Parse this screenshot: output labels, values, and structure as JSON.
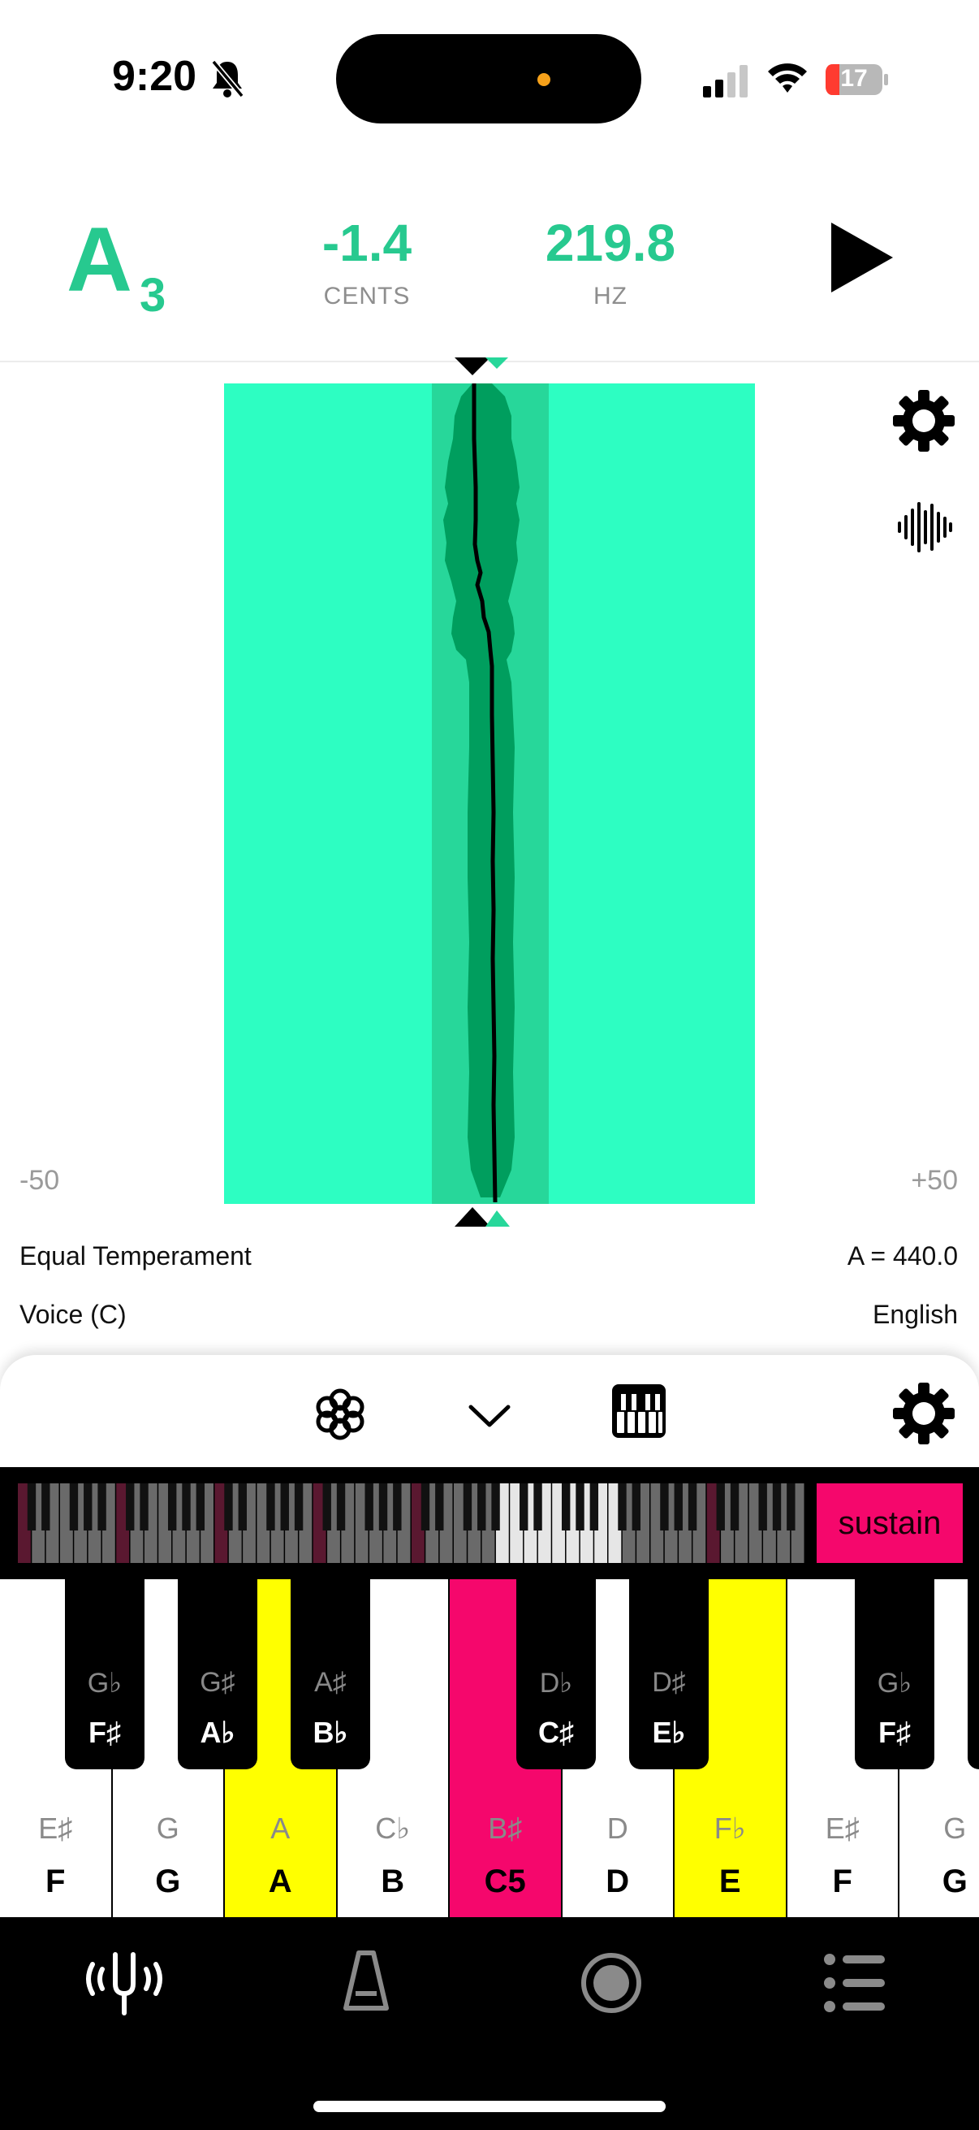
{
  "status_bar": {
    "time": "9:20",
    "battery": "17"
  },
  "header": {
    "note": "A",
    "octave": "3",
    "cents_value": "-1.4",
    "cents_label": "CENTS",
    "hz_value": "219.8",
    "hz_label": "HZ"
  },
  "graph": {
    "scale_min": "-50",
    "scale_max": "+50"
  },
  "settings": {
    "temperament": "Equal Temperament",
    "reference_pitch": "A = 440.0",
    "instrument": "Voice (C)",
    "language": "English"
  },
  "keyboard": {
    "sustain_label": "sustain",
    "white_keys": [
      {
        "alt": "E♯",
        "label": "F",
        "color": "#ffffff"
      },
      {
        "alt": "G",
        "label": "G",
        "color": "#ffffff"
      },
      {
        "alt": "A",
        "label": "A",
        "color": "#ffff00"
      },
      {
        "alt": "C♭",
        "label": "B",
        "color": "#ffffff"
      },
      {
        "alt": "B♯",
        "label": "C5",
        "color": "#f5076c"
      },
      {
        "alt": "D",
        "label": "D",
        "color": "#ffffff"
      },
      {
        "alt": "F♭",
        "label": "E",
        "color": "#ffff00"
      },
      {
        "alt": "E♯",
        "label": "F",
        "color": "#ffffff"
      },
      {
        "alt": "G",
        "label": "G",
        "color": "#ffffff"
      }
    ],
    "black_keys": [
      {
        "alt": "G♭",
        "label": "F♯"
      },
      {
        "alt": "G♯",
        "label": "A♭"
      },
      {
        "alt": "A♯",
        "label": "B♭"
      },
      {
        "alt": "D♭",
        "label": "C♯"
      },
      {
        "alt": "D♯",
        "label": "E♭"
      },
      {
        "alt": "G♭",
        "label": "F♯"
      }
    ]
  },
  "tabs": [
    {
      "icon": "tuning-fork-icon"
    },
    {
      "icon": "metronome-icon"
    },
    {
      "icon": "record-icon"
    },
    {
      "icon": "list-icon"
    }
  ],
  "colors": {
    "accent": "#27c98f",
    "graph_bg": "#2dfec2",
    "graph_band": "#27d79a",
    "trace_fill": "#009e5e",
    "highlight_yellow": "#ffff00",
    "highlight_pink": "#f5076c"
  }
}
